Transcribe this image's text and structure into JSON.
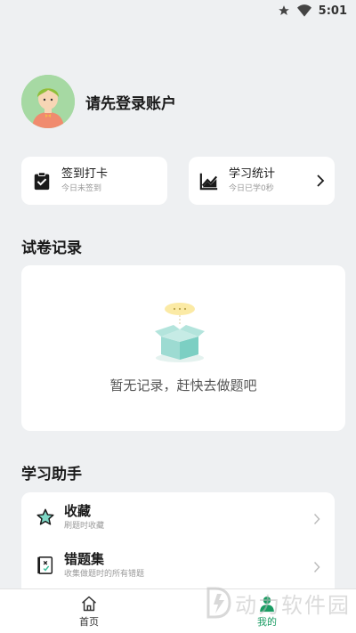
{
  "status_bar": {
    "time": "5:01",
    "icons": [
      "star-icon",
      "wifi-icon"
    ]
  },
  "profile": {
    "login_prompt": "请先登录账户",
    "avatar_icon": "avatar-icon"
  },
  "quick_actions": [
    {
      "title": "签到打卡",
      "subtitle": "今日未签到",
      "icon": "clipboard-check-icon"
    },
    {
      "title": "学习统计",
      "subtitle": "今日已学0秒",
      "icon": "trend-chart-icon"
    }
  ],
  "records": {
    "title": "试卷记录",
    "empty_text": "暂无记录，赶快去做题吧"
  },
  "assistant": {
    "title": "学习助手",
    "items": [
      {
        "title": "收藏",
        "subtitle": "刷题时收藏",
        "icon": "star-outline-icon"
      },
      {
        "title": "错题集",
        "subtitle": "收集做题时的所有错题",
        "icon": "wrong-book-icon"
      }
    ]
  },
  "tabs": [
    {
      "label": "首页",
      "icon": "home-icon",
      "active": false
    },
    {
      "label": "我的",
      "icon": "user-icon",
      "active": true
    }
  ],
  "watermark": {
    "text": "动力软件园"
  },
  "colors": {
    "accent": "#1a9c63",
    "background": "#eef0f2",
    "card": "#ffffff"
  }
}
